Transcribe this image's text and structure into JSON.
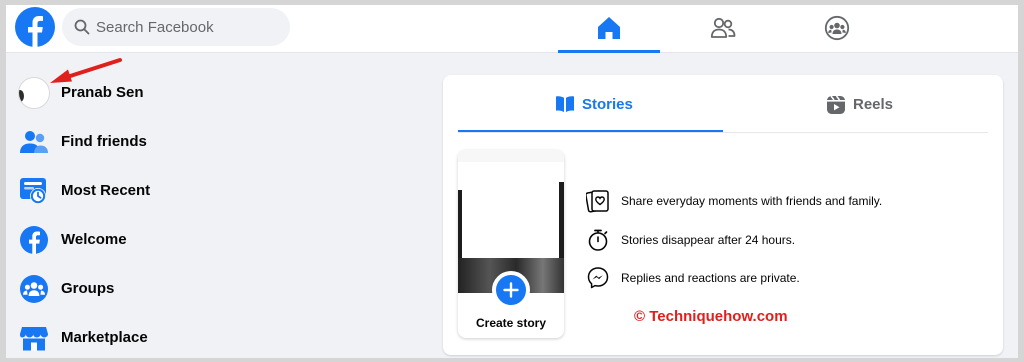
{
  "topbar": {
    "logo_icon": "facebook-logo-icon",
    "search_placeholder": "Search Facebook",
    "nav_tabs": [
      {
        "name": "home",
        "icon": "home-icon",
        "active": true
      },
      {
        "name": "friends",
        "icon": "friends-icon",
        "active": false
      },
      {
        "name": "groups",
        "icon": "groups-icon",
        "active": false
      }
    ]
  },
  "sidebar": {
    "items": [
      {
        "label": "Pranab Sen",
        "icon": "avatar"
      },
      {
        "label": "Find friends",
        "icon": "find-friends-icon"
      },
      {
        "label": "Most Recent",
        "icon": "most-recent-icon"
      },
      {
        "label": "Welcome",
        "icon": "facebook-welcome-icon"
      },
      {
        "label": "Groups",
        "icon": "groups-icon"
      },
      {
        "label": "Marketplace",
        "icon": "marketplace-icon"
      }
    ]
  },
  "stories_card": {
    "tabs": [
      {
        "label": "Stories",
        "icon": "book-icon",
        "active": true
      },
      {
        "label": "Reels",
        "icon": "reels-icon",
        "active": false
      }
    ],
    "create_story_label": "Create story",
    "info": [
      {
        "text": "Share everyday moments with friends and family.",
        "icon": "photo-heart-icon"
      },
      {
        "text": "Stories disappear after 24 hours.",
        "icon": "stopwatch-icon"
      },
      {
        "text": "Replies and reactions are private.",
        "icon": "messenger-icon"
      }
    ]
  },
  "watermark": "© Techniquehow.com",
  "colors": {
    "brand_blue": "#1877f2",
    "page_bg": "#f0f2f5",
    "annotation_red": "#e0201d"
  }
}
